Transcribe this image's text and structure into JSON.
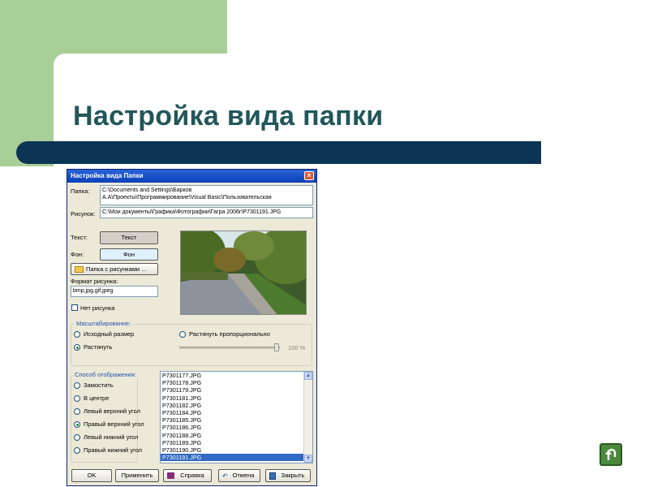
{
  "slide": {
    "title": "Настройка вида папки"
  },
  "dialog": {
    "title": "Настройка вида Папки",
    "close_symbol": "×",
    "folder_label": "Папка:",
    "folder_value_line1": "C:\\Documents and Settings\\Барков",
    "folder_value_line2": "А.А\\Проекты\\Программирование\\Visual Basic\\Пользовательская",
    "picture_label": "Рисунок:",
    "picture_value": "C:\\Мои документы\\Графика\\Фотографии\\Гагра 2006г\\P7301191.JPG",
    "text_label": "Текст:",
    "text_button": "Текст",
    "bg_label": "Фон:",
    "bg_button": "Фон",
    "folder_button": "Папка с рисунками ...",
    "format_label": "Формат рисунка:",
    "format_value": "bmp,jpg,gif,jpeg",
    "no_picture_label": "Нет рисунка",
    "scaling": {
      "legend": "Масштабирование:",
      "original": "Исходный размер",
      "stretch": "Растянуть",
      "stretch_proportional": "Растянуть пропорционально",
      "percent": "100 %",
      "slider_value": 100
    },
    "display": {
      "legend": "Способ отображения:",
      "options": [
        "Замостить",
        "В центре",
        "Левый верхний угол",
        "Правый верхний угол",
        "Левый нижний угол",
        "Правый нижний угол"
      ],
      "selected": "Правый верхний угол"
    },
    "files": [
      "P7301177.JPG",
      "P7301178.JPG",
      "P7301179.JPG",
      "P7301181.JPG",
      "P7301182.JPG",
      "P7301184.JPG",
      "P7301185.JPG",
      "P7301186.JPG",
      "P7301188.JPG",
      "P7301189.JPG",
      "P7301190.JPG",
      "P7301191.JPG"
    ],
    "selected_file": "P7301191.JPG",
    "buttons": {
      "ok": "OK",
      "apply": "Применить",
      "help": "Справка",
      "cancel": "Отмена",
      "close": "Закрыть"
    }
  },
  "colors": {
    "title_color": "#22565a",
    "bar_color": "#0c3454",
    "accent_green": "#a9cf98",
    "selection": "#316ac5"
  },
  "icons": [
    "folder-icon",
    "help-book-icon",
    "undo-icon",
    "close-door-icon",
    "return-arrow-icon"
  ]
}
